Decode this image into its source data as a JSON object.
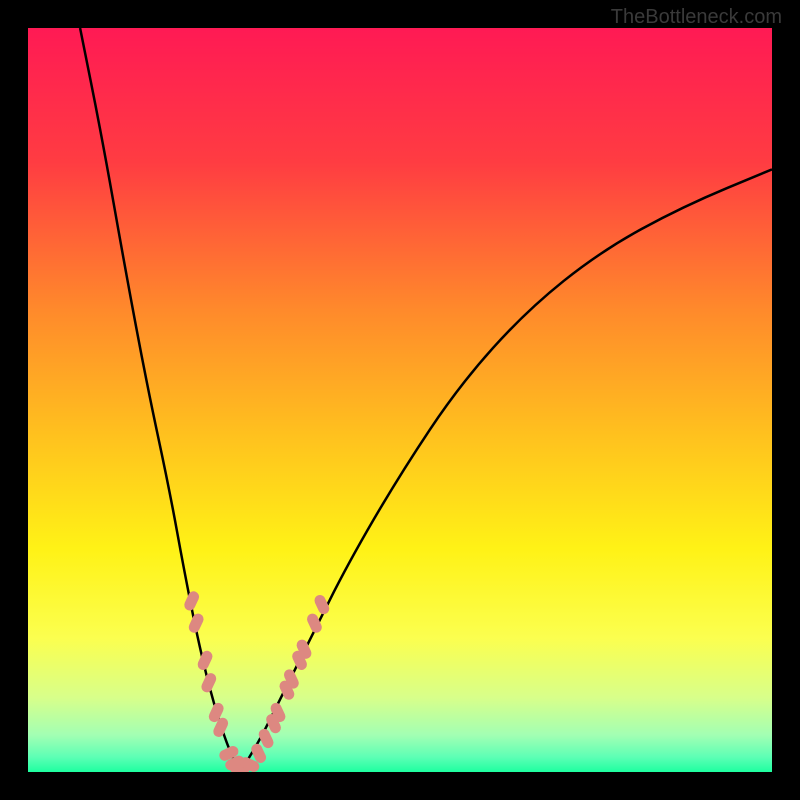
{
  "watermark": "TheBottleneck.com",
  "chart_data": {
    "type": "line",
    "title": "",
    "xlabel": "",
    "ylabel": "",
    "xlim": [
      0,
      100
    ],
    "ylim": [
      0,
      100
    ],
    "curve_left": {
      "description": "Steep descending curve from top toward valley minimum",
      "x": [
        7,
        10,
        13,
        16,
        19,
        21,
        23,
        25,
        27,
        28.5
      ],
      "y": [
        100,
        85,
        68,
        52,
        38,
        27,
        17,
        9,
        3,
        0
      ]
    },
    "curve_right": {
      "description": "Ascending curve from valley minimum toward right edge, concave down",
      "x": [
        28.5,
        31,
        34,
        38,
        43,
        50,
        58,
        67,
        77,
        88,
        100
      ],
      "y": [
        0,
        4,
        10,
        18,
        28,
        40,
        52,
        62,
        70,
        76,
        81
      ]
    },
    "valley_min_x": 28.5,
    "markers": {
      "description": "Salmon-colored rounded markers clustered near valley bottom on both branches",
      "color": "#dd8881",
      "points": [
        {
          "x": 22.0,
          "y": 23
        },
        {
          "x": 22.6,
          "y": 20
        },
        {
          "x": 23.8,
          "y": 15
        },
        {
          "x": 24.3,
          "y": 12
        },
        {
          "x": 25.3,
          "y": 8
        },
        {
          "x": 25.9,
          "y": 6
        },
        {
          "x": 27.0,
          "y": 2.5
        },
        {
          "x": 27.8,
          "y": 1.2
        },
        {
          "x": 28.5,
          "y": 0.5
        },
        {
          "x": 29.8,
          "y": 1.0
        },
        {
          "x": 31.0,
          "y": 2.5
        },
        {
          "x": 32.0,
          "y": 4.5
        },
        {
          "x": 33.0,
          "y": 6.5
        },
        {
          "x": 33.6,
          "y": 8.0
        },
        {
          "x": 34.8,
          "y": 11
        },
        {
          "x": 35.4,
          "y": 12.5
        },
        {
          "x": 36.5,
          "y": 15
        },
        {
          "x": 37.1,
          "y": 16.5
        },
        {
          "x": 38.5,
          "y": 20
        },
        {
          "x": 39.5,
          "y": 22.5
        }
      ]
    },
    "gradient_stops": [
      {
        "offset": 0,
        "color": "#ff1a54"
      },
      {
        "offset": 18,
        "color": "#ff3c42"
      },
      {
        "offset": 38,
        "color": "#ff8a2b"
      },
      {
        "offset": 55,
        "color": "#ffc21e"
      },
      {
        "offset": 70,
        "color": "#fff216"
      },
      {
        "offset": 82,
        "color": "#fbff4f"
      },
      {
        "offset": 90,
        "color": "#d8ff8a"
      },
      {
        "offset": 95,
        "color": "#a3ffb3"
      },
      {
        "offset": 98,
        "color": "#5dffb5"
      },
      {
        "offset": 100,
        "color": "#1effa0"
      }
    ]
  }
}
